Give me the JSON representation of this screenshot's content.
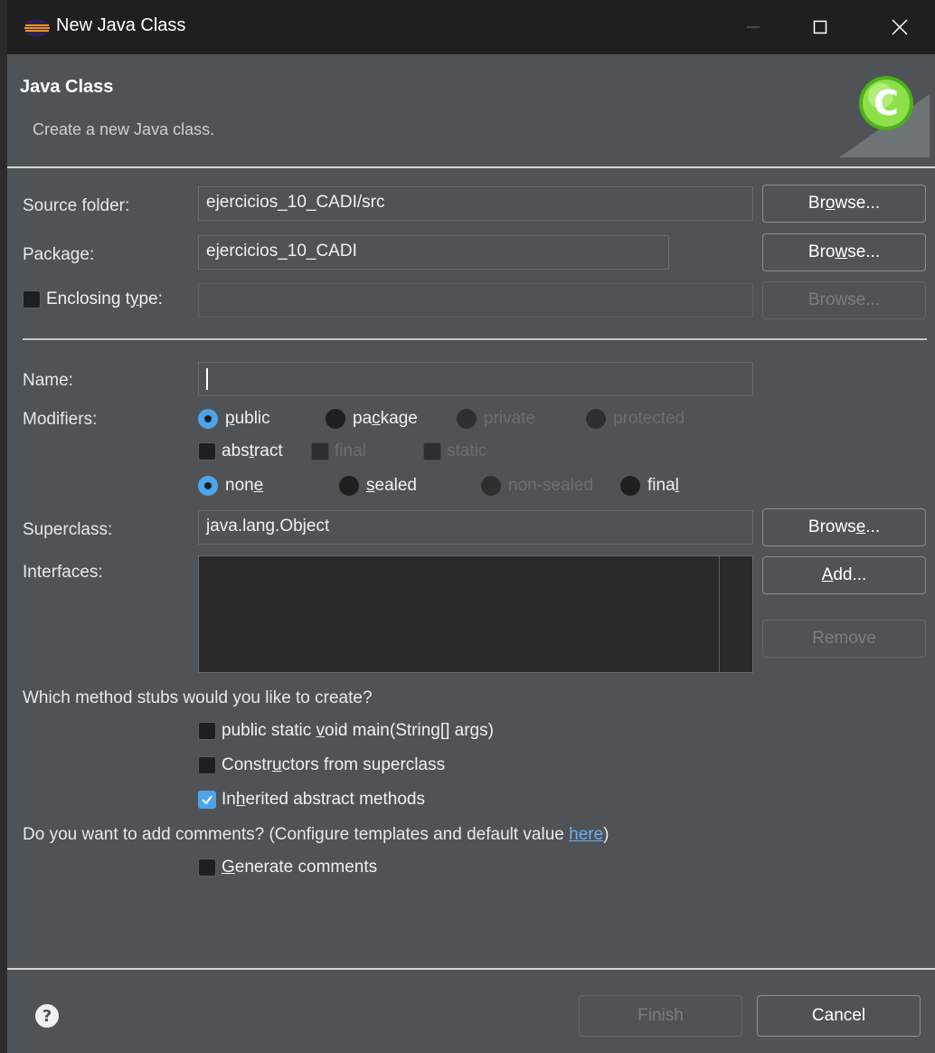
{
  "window": {
    "title": "New Java Class"
  },
  "header": {
    "title": "Java Class",
    "description": "Create a new Java class."
  },
  "source_folder": {
    "label": "Source folder:",
    "value": "ejercicios_10_CADI/src",
    "browse_pre": "Br",
    "browse_key": "o",
    "browse_post": "wse..."
  },
  "package": {
    "label": "Package:",
    "value": "ejercicios_10_CADI",
    "browse_pre": "Bro",
    "browse_key": "w",
    "browse_post": "se..."
  },
  "enclosing": {
    "label_pre": "Enclosing t",
    "label_key": "y",
    "label_post": "pe:",
    "checked": false,
    "value": "",
    "browse": "Browse..."
  },
  "name": {
    "label": "Name:",
    "value": ""
  },
  "modifiers": {
    "label": "Modifiers:",
    "public_key": "p",
    "public_rest": "ublic",
    "package_pre": "pa",
    "package_key": "c",
    "package_post": "kage",
    "private": "private",
    "protected": "protected",
    "abstract_pre": "abs",
    "abstract_key": "t",
    "abstract_post": "ract",
    "final": "final",
    "static": "static",
    "none_pre": "non",
    "none_key": "e",
    "sealed_key": "s",
    "sealed_rest": "ealed",
    "non_sealed": "non-sealed",
    "final2_pre": "fina",
    "final2_key": "l",
    "selected_access": "public",
    "selected_inheritance": "none"
  },
  "superclass": {
    "label": "Superclass:",
    "value": "java.lang.Object",
    "browse_pre": "Brows",
    "browse_key": "e",
    "browse_post": "..."
  },
  "interfaces": {
    "label": "Interfaces:",
    "add_key": "A",
    "add_rest": "dd...",
    "remove": "Remove"
  },
  "stubs": {
    "question": "Which method stubs would you like to create?",
    "main_pre": "public static ",
    "main_key": "v",
    "main_post": "oid main(String[] args)",
    "main_checked": false,
    "constructors_pre": "Constr",
    "constructors_key": "u",
    "constructors_post": "ctors from superclass",
    "constructors_checked": false,
    "inherited_pre": "In",
    "inherited_key": "h",
    "inherited_post": "erited abstract methods",
    "inherited_checked": true
  },
  "comments": {
    "question": "Do you want to add comments? (Configure templates and default value ",
    "link": "here",
    "question_end": ")",
    "generate_key": "G",
    "generate_rest": "enerate comments",
    "generate_checked": false
  },
  "footer": {
    "finish": "Finish",
    "cancel": "Cancel"
  },
  "colors": {
    "accent": "#4ea4e8",
    "link": "#6ab0f3",
    "background": "#4f5355",
    "titlebar": "#1f1f1f"
  }
}
